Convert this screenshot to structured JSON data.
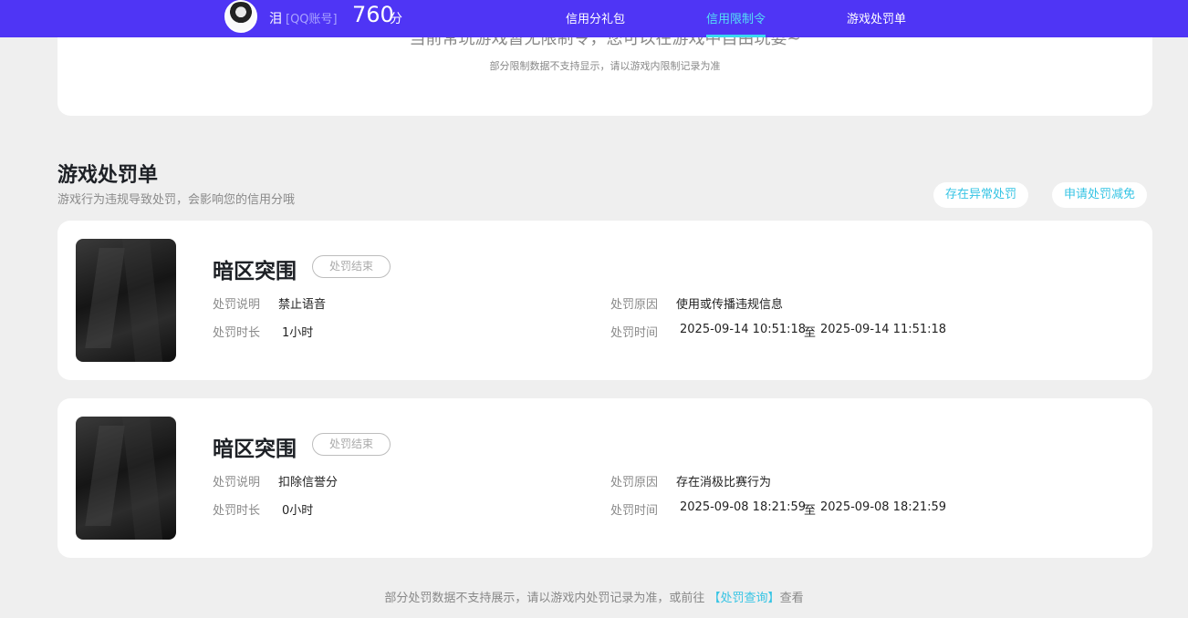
{
  "header": {
    "username": "泪",
    "account_type": "[QQ账号]",
    "score": "760",
    "score_unit": "分",
    "tabs": [
      {
        "label": "信用分礼包",
        "active": false
      },
      {
        "label": "信用限制令",
        "active": true
      },
      {
        "label": "游戏处罚单",
        "active": false
      }
    ]
  },
  "restriction": {
    "title": "当前常玩游戏暂无限制令，您可以在游戏中自由玩耍~",
    "note": "部分限制数据不支持显示，请以游戏内限制记录为准"
  },
  "penalties_section": {
    "title": "游戏处罚单",
    "subtitle": "游戏行为违规导致处罚，会影响您的信用分哦",
    "actions": [
      "存在异常处罚",
      "申请处罚减免"
    ]
  },
  "labels": {
    "description": "处罚说明",
    "duration": "处罚时长",
    "reason": "处罚原因",
    "time": "处罚时间",
    "range_sep": "至"
  },
  "penalties": [
    {
      "game": "暗区突围",
      "status": "处罚结束",
      "description": "禁止语音",
      "duration": "1小时",
      "reason": "使用或传播违规信息",
      "start": "2025-09-14 10:51:18",
      "end": "2025-09-14 11:51:18"
    },
    {
      "game": "暗区突围",
      "status": "处罚结束",
      "description": "扣除信誉分",
      "duration": "0小时",
      "reason": "存在消极比赛行为",
      "start": "2025-09-08 18:21:59",
      "end": "2025-09-08 18:21:59"
    }
  ],
  "footer": {
    "text_before": "部分处罚数据不支持展示，请以游戏内处罚记录为准，或前往 ",
    "link": "【处罚查询】",
    "text_after": "查看"
  }
}
